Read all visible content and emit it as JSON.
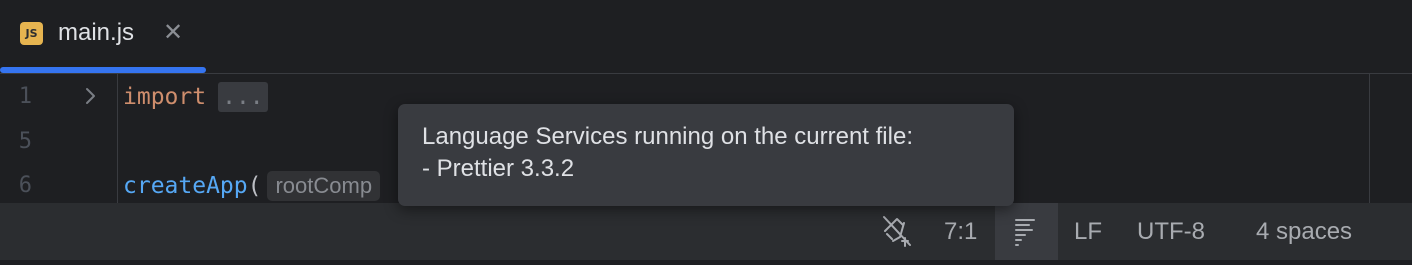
{
  "tab": {
    "file_name": "main.js",
    "icon_text": "JS",
    "icon": "js-file-icon",
    "close_glyph": "✕"
  },
  "editor": {
    "lines": [
      {
        "number": "1",
        "keyword": "import",
        "folded_placeholder": "..."
      },
      {
        "number": "5"
      },
      {
        "number": "6",
        "function": "createApp",
        "paren": "(",
        "param_hint": "rootComp"
      }
    ]
  },
  "tooltip": {
    "line1": "Language Services running on the current file:",
    "line2": "- Prettier 3.3.2"
  },
  "statusbar": {
    "inspection_icon": "no-inspections-icon",
    "position": "7:1",
    "language_services_icon": "language-services-icon",
    "line_separator": "LF",
    "encoding": "UTF-8",
    "indent": "4 spaces"
  },
  "colors": {
    "accent": "#3574f0",
    "keyword": "#cf8e6d",
    "function": "#56a8f5",
    "js_badge": "#e6b450"
  }
}
